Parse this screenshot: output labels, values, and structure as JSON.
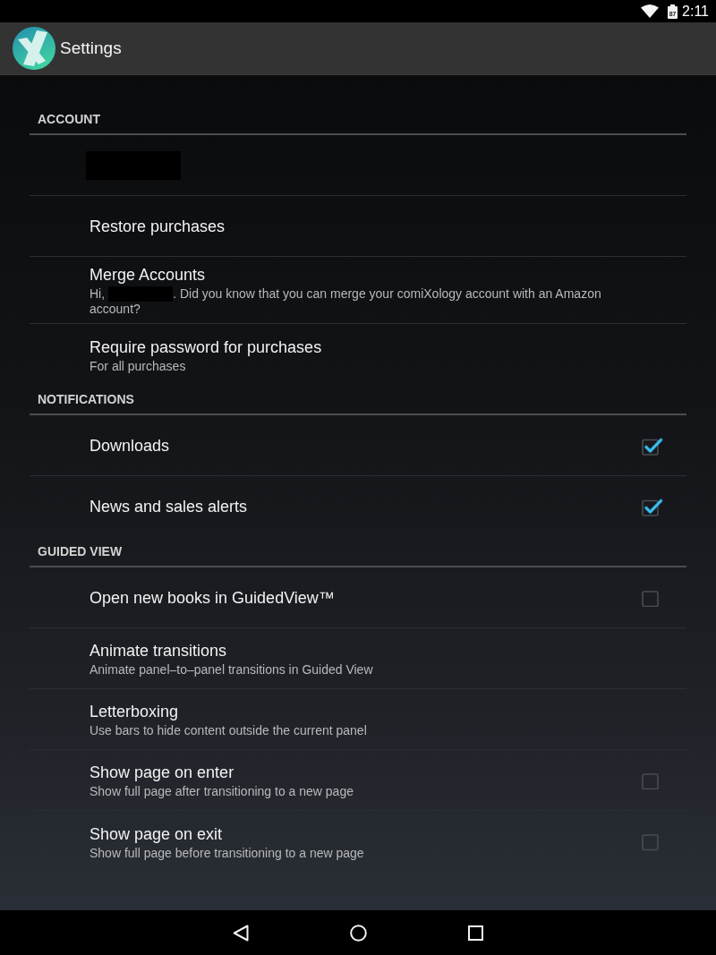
{
  "status_bar": {
    "battery": "87",
    "time": "2:11"
  },
  "action_bar": {
    "title": "Settings"
  },
  "sections": [
    {
      "title": "ACCOUNT",
      "items": [
        {
          "kind": "redacted"
        },
        {
          "kind": "text",
          "title": "Restore purchases"
        },
        {
          "kind": "text",
          "title": "Merge Accounts",
          "summary": [
            {
              "kind": "text",
              "text": "Hi,"
            },
            {
              "kind": "redacted"
            },
            {
              "kind": "text",
              "text": ". Did you know that you can merge your comiXology account with an Amazon account?"
            }
          ]
        },
        {
          "kind": "text",
          "title": "Require password for purchases",
          "summary": [
            {
              "kind": "text",
              "text": "For all purchases"
            }
          ]
        }
      ]
    },
    {
      "title": "NOTIFICATIONS",
      "items": [
        {
          "kind": "checkbox",
          "title": "Downloads",
          "checked": true
        },
        {
          "kind": "checkbox",
          "title": "News and sales alerts",
          "checked": true
        }
      ]
    },
    {
      "title": "GUIDED VIEW",
      "items": [
        {
          "kind": "checkbox",
          "title": "Open new books in GuidedView™",
          "checked": false
        },
        {
          "kind": "text",
          "title": "Animate transitions",
          "summary": [
            {
              "kind": "text",
              "text": "Animate panel–to–panel transitions in Guided View"
            }
          ]
        },
        {
          "kind": "text",
          "title": "Letterboxing",
          "summary": [
            {
              "kind": "text",
              "text": "Use bars to hide content outside the current panel"
            }
          ]
        },
        {
          "kind": "checkbox",
          "title": "Show page on enter",
          "summary": [
            {
              "kind": "text",
              "text": "Show full page after transitioning to a new page"
            }
          ],
          "checked": false
        },
        {
          "kind": "checkbox",
          "title": "Show page on exit",
          "summary": [
            {
              "kind": "text",
              "text": "Show full page before transitioning to a new page"
            }
          ],
          "checked": false
        }
      ]
    }
  ]
}
